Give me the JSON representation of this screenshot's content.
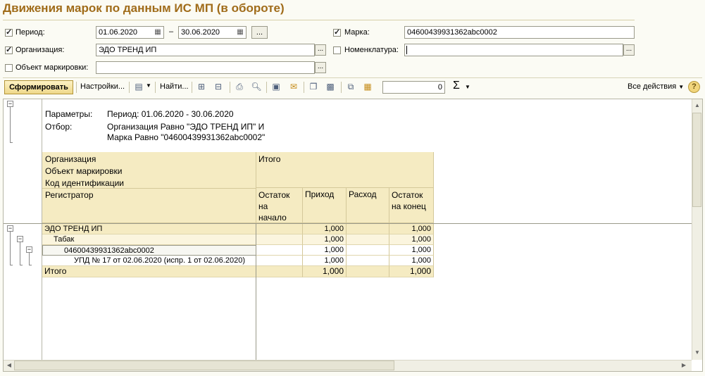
{
  "title": "Движения марок по данным ИС МП (в обороте)",
  "filters": {
    "period": {
      "label": "Период:",
      "checked": true,
      "from": "01.06.2020",
      "dash": "–",
      "to": "30.06.2020",
      "more": "..."
    },
    "marka": {
      "label": "Марка:",
      "checked": true,
      "value": "04600439931362abc0002"
    },
    "organization": {
      "label": "Организация:",
      "checked": true,
      "value": "ЭДО ТРЕНД ИП",
      "more": "..."
    },
    "nomenclature": {
      "label": "Номенклатура:",
      "checked": false,
      "value": "",
      "more": "..."
    },
    "object": {
      "label": "Объект маркировки:",
      "checked": false,
      "value": "",
      "more": "..."
    }
  },
  "toolbar": {
    "generate": "Сформировать",
    "settings": "Настройки...",
    "find": "Найти...",
    "sum_value": "0",
    "sigma": "Σ",
    "all_actions": "Все действия",
    "help": "?"
  },
  "report": {
    "params_label": "Параметры:",
    "params_value": "Период: 01.06.2020 - 30.06.2020",
    "filter_label": "Отбор:",
    "filter_line1": "Организация Равно \"ЭДО ТРЕНД ИП\" И",
    "filter_line2": "Марка Равно \"04600439931362abc0002\"",
    "header": {
      "organization": "Организация",
      "object": "Объект маркировки",
      "code": "Код идентификации",
      "registrar": "Регистратор",
      "total": "Итого",
      "opening": "Остаток на начало",
      "in": "Приход",
      "out": "Расход",
      "closing": "Остаток на конец"
    },
    "rows": [
      {
        "name": "ЭДО ТРЕНД ИП",
        "opening": "",
        "in": "1,000",
        "out": "",
        "closing": "1,000"
      },
      {
        "name": "Табак",
        "opening": "",
        "in": "1,000",
        "out": "",
        "closing": "1,000"
      },
      {
        "name": "04600439931362abc0002",
        "opening": "",
        "in": "1,000",
        "out": "",
        "closing": "1,000"
      },
      {
        "name": "УПД № 17 от 02.06.2020 (испр. 1 от 02.06.2020)",
        "opening": "",
        "in": "1,000",
        "out": "",
        "closing": "1,000"
      }
    ],
    "total": {
      "name": "Итого",
      "opening": "",
      "in": "1,000",
      "out": "",
      "closing": "1,000"
    }
  }
}
